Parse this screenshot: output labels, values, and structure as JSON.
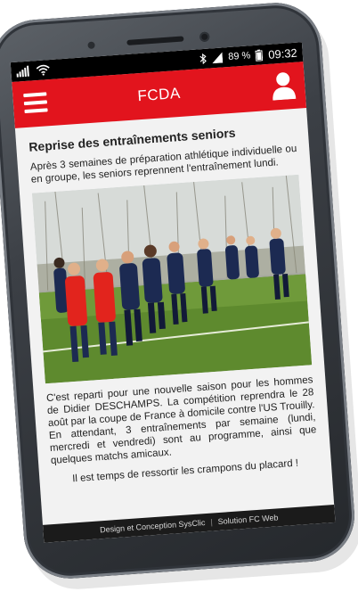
{
  "status_bar": {
    "battery_label": "89 %",
    "time": "09:32"
  },
  "app_bar": {
    "title": "FCDA",
    "menu_icon": "hamburger-menu-icon",
    "profile_icon": "user-icon",
    "color": "#e2141d"
  },
  "article": {
    "title": "Reprise des entraînements seniors",
    "intro": "Après 3 semaines de préparation athlétique individuelle ou en groupe, les seniors reprennent l'entraînement lundi.",
    "body": "C'est reparti pour une nouvelle saison pour les hommes de Didier DESCHAMPS. La compétition reprendra le 28 août par la coupe de France à domicile contre l'US Trouilly. En attendant, 3 entraînements par semaine (lundi, mercredi et vendredi) sont au programme, ainsi que quelques matchs amicaux.",
    "closing": "Il est temps de ressortir les crampons du placard !"
  },
  "footer": {
    "design_credit": "Design et Conception SysClic",
    "solution_credit": "Solution FC Web"
  }
}
